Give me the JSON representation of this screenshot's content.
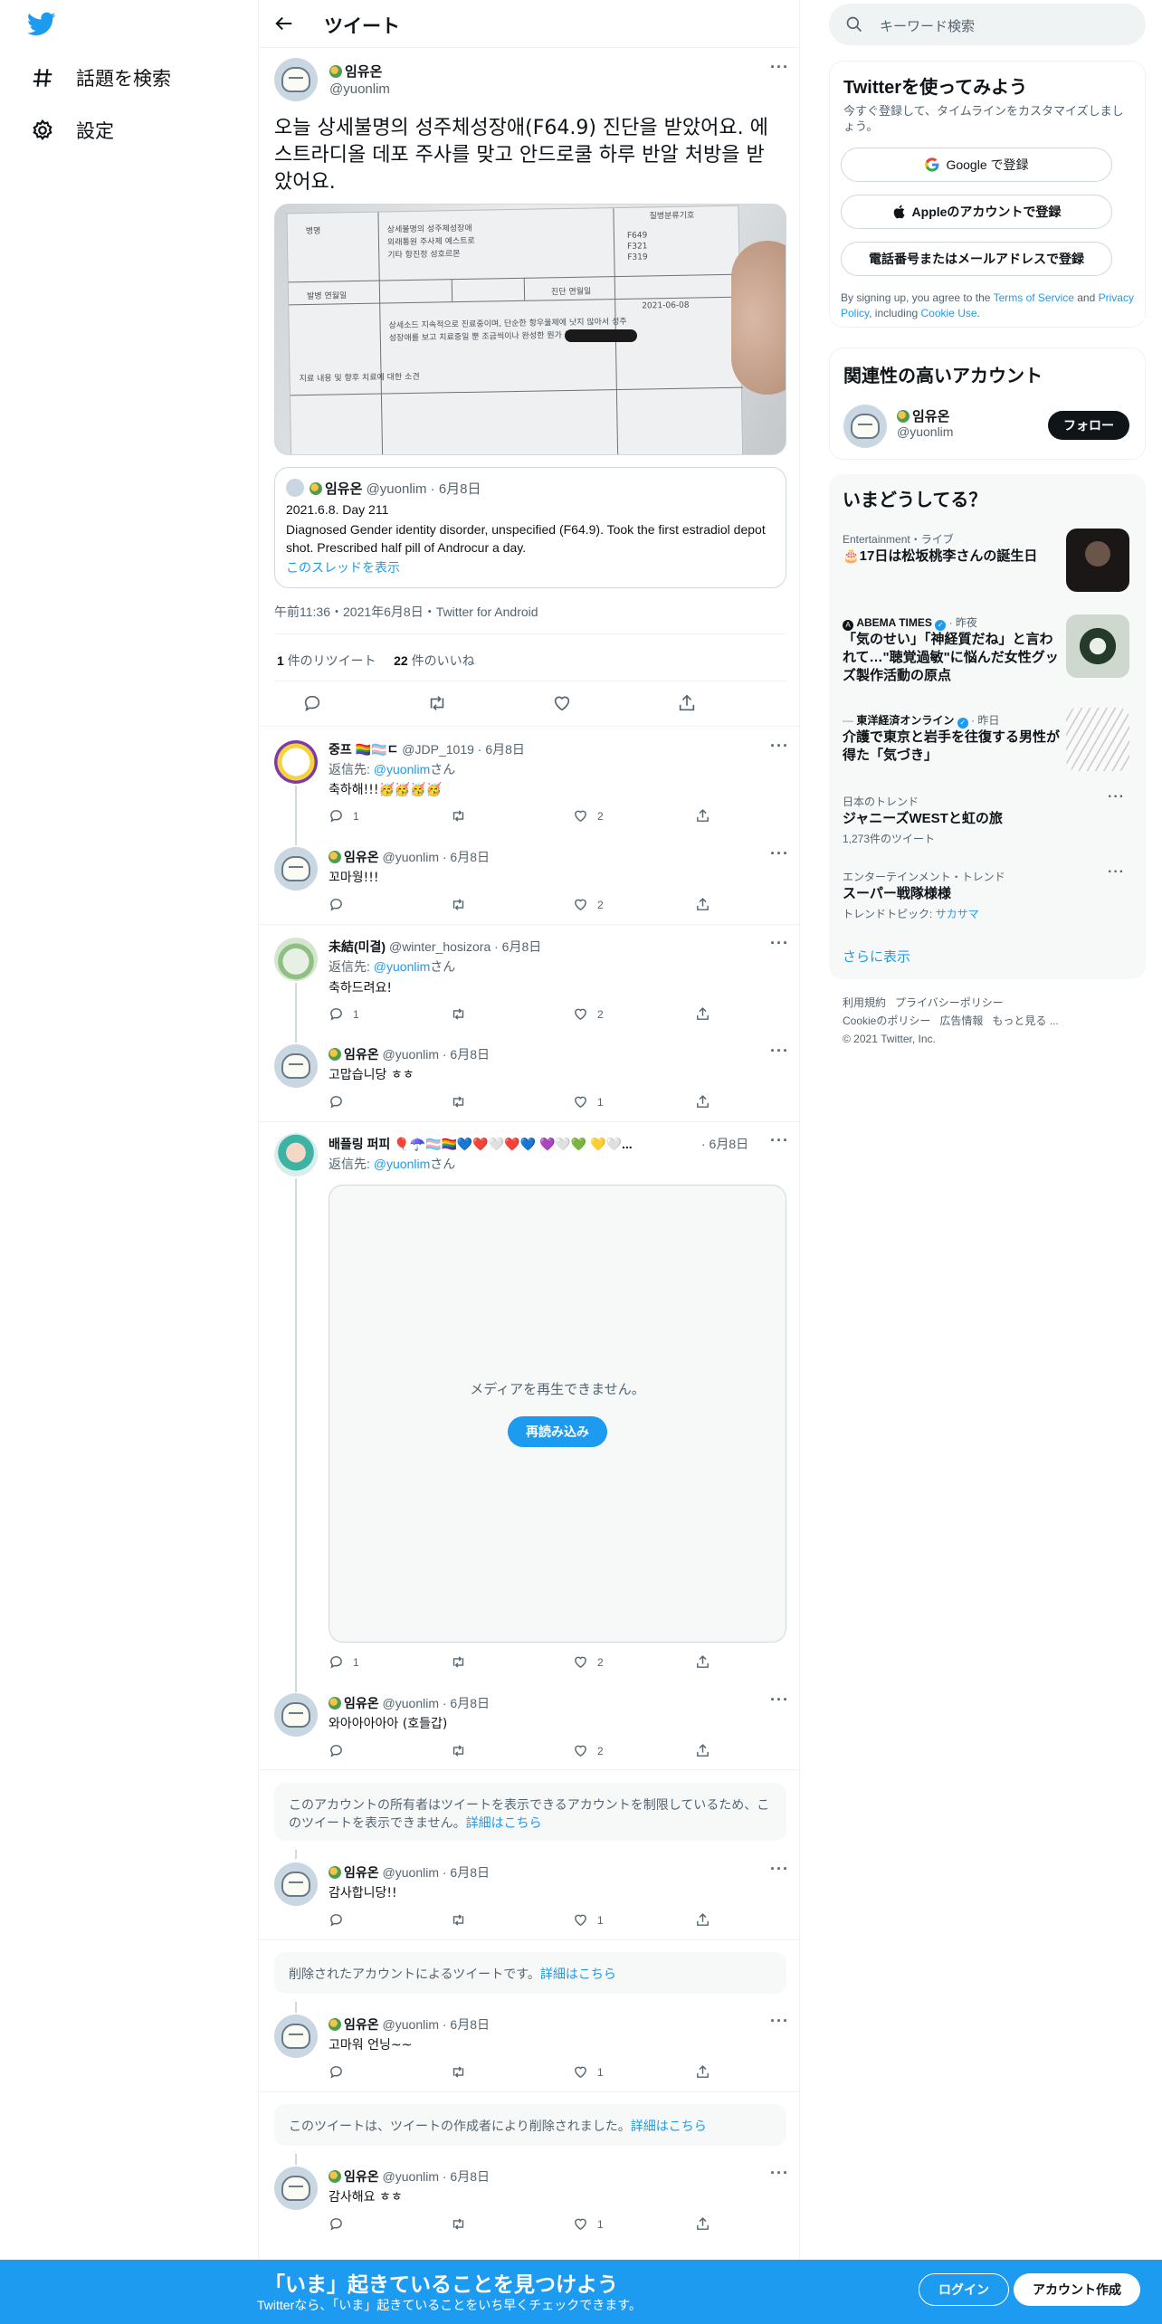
{
  "nav": {
    "explore_label": "話題を検索",
    "settings_label": "設定"
  },
  "header": {
    "title": "ツイート"
  },
  "main_tweet": {
    "name": "임유온",
    "handle": "@yuonlim",
    "text": "오늘 상세불명의 성주체성장애(F64.9) 진단을 받았어요. 에스트라디올 데포 주사를 맞고 안드로쿨 하루 반알 처방을 받았어요.",
    "quote": {
      "name": "임유온",
      "handle_date": "@yuonlim · 6月8日",
      "line1": "2021.6.8. Day 211",
      "line2": "Diagnosed Gender identity disorder, unspecified (F64.9). Took the first estradiol depot shot. Prescribed half pill of Androcur a day.",
      "thread_link": "このスレッドを表示"
    },
    "timestamp": "午前11:36・2021年6月8日・Twitter for Android",
    "retweets_count": "1",
    "retweets_label": " 件のリツイート",
    "likes_count": "22",
    "likes_label": " 件のいいね",
    "photo_text": {
      "t1": "상세불명의 성주체성장애",
      "t2": "외래통원 주사제 예스트로",
      "t3": "기타 항진정 성호르몬",
      "t4": "F649",
      "t5": "F321",
      "t6": "F319",
      "t7": "2021-06-08",
      "t8": "상세소드 지속적으로 진료중이며, 단순한 항우울제에 낫지 않아서 성주",
      "t9": "성장애를 보고 치료중일 뿐 조금씩이나 완성한 뭔가 봅니다.",
      "t10": "지료 내용 및 향후 치료에 대한 소견",
      "t11": "병명",
      "t12": "발병 연월일",
      "t13": "진단 연월일",
      "t14": "질병분류기호"
    }
  },
  "replies": [
    {
      "name": "중프 🏳️‍🌈🏳️‍⚧️ㄷ",
      "handle_date": "@JDP_1019 · 6月8日",
      "reply_to_prefix": "返信先: ",
      "reply_to_handle": "@yuonlim",
      "reply_to_suffix": "さん",
      "text": "축하해!!!🥳🥳🥳🥳",
      "reply": "1",
      "retweet": "",
      "like": "2"
    },
    {
      "name": "임유온",
      "handle_date": "@yuonlim · 6月8日",
      "text": "꼬마웡!!!",
      "reply": "",
      "retweet": "",
      "like": "2"
    },
    {
      "name": "未結(미결)",
      "handle_date": "@winter_hosizora · 6月8日",
      "reply_to_prefix": "返信先: ",
      "reply_to_handle": "@yuonlim",
      "reply_to_suffix": "さん",
      "text": "축하드려요!",
      "reply": "1",
      "retweet": "",
      "like": "2"
    },
    {
      "name": "임유온",
      "handle_date": "@yuonlim · 6月8日",
      "text": "고맙습니당 ㅎㅎ",
      "reply": "",
      "retweet": "",
      "like": "1"
    },
    {
      "name": "배플링 퍼피 🎈☂️🏳️‍⚧️🏳️‍🌈💙❤️🤍❤️💙 💜🤍💚 💛🤍...",
      "handle_date": "· 6月8日",
      "reply_to_prefix": "返信先: ",
      "reply_to_handle": "@yuonlim",
      "reply_to_suffix": "さん",
      "text": "",
      "reply": "1",
      "retweet": "",
      "like": "2"
    },
    {
      "name": "임유온",
      "handle_date": "@yuonlim · 6月8日",
      "text": "와아아아아아 (호들갑)",
      "reply": "",
      "retweet": "",
      "like": "2"
    },
    {
      "name": "임유온",
      "handle_date": "@yuonlim · 6月8日",
      "text": "감사합니당!!",
      "reply": "",
      "retweet": "",
      "like": "1"
    },
    {
      "name": "임유온",
      "handle_date": "@yuonlim · 6月8日",
      "text": "고마워 언닝~~",
      "reply": "",
      "retweet": "",
      "like": "1"
    },
    {
      "name": "임유온",
      "handle_date": "@yuonlim · 6月8日",
      "text": "감사해요 ㅎㅎ",
      "reply": "",
      "retweet": "",
      "like": "1"
    }
  ],
  "video": {
    "message": "メディアを再生できません。",
    "reload": "再読み込み"
  },
  "notices": {
    "protected": "このアカウントの所有者はツイートを表示できるアカウントを制限しているため、このツイートを表示できません。",
    "protected_link": "詳細はこちら",
    "deleted_account": "削除されたアカウントによるツイートです。",
    "deleted_account_link": "詳細はこちら",
    "deleted_tweet": "このツイートは、ツイートの作成者により削除されました。",
    "deleted_tweet_link": "詳細はこちら"
  },
  "sidebar": {
    "search_placeholder": "キーワード検索",
    "signup": {
      "title": "Twitterを使ってみよう",
      "desc": "今すぐ登録して、タイムラインをカスタマイズしましょう。",
      "google": "Google で登録",
      "apple": "Appleのアカウントで登録",
      "phone": "電話番号またはメールアドレスで登録",
      "legal_pre": "By signing up, you agree to the ",
      "tos": "Terms of Service",
      "legal_and": " and ",
      "privacy": "Privacy Policy",
      "legal_including": ", including ",
      "cookie": "Cookie Use",
      "legal_end": "."
    },
    "related": {
      "title": "関連性の高いアカウント",
      "name": "임유온",
      "handle": "@yuonlim",
      "follow": "フォロー"
    },
    "trends": {
      "title": "いまどうしてる？",
      "items": [
        {
          "meta": "Entertainment・ライブ",
          "title": "🎂17日は松坂桃李さんの誕生日"
        },
        {
          "meta_source": "ABEMA TIMES",
          "meta_time": " · 昨夜",
          "title": "「気のせい」「神経質だね」と言われて…\"聴覚過敏\"に悩んだ女性グッズ製作活動の原点"
        },
        {
          "meta_source": "東洋経済オンライン",
          "meta_time": " · 昨日",
          "title": "介護で東京と岩手を往復する男性が得た「気づき」"
        },
        {
          "meta": "日本のトレンド",
          "title": "ジャニーズWESTと虹の旅",
          "sub": "1,273件のツイート"
        },
        {
          "meta": "エンターテインメント・トレンド",
          "title": "スーパー戦隊様様",
          "sub_prefix": "トレンドトピック: ",
          "sub_link": "サカサマ"
        }
      ],
      "show_more": "さらに表示"
    },
    "footer": {
      "terms": "利用規約",
      "privacy": "プライバシーポリシー",
      "cookie": "Cookieのポリシー",
      "ads": "広告情報",
      "more": "もっと見る ...",
      "copyright": "© 2021 Twitter, Inc."
    }
  },
  "bottom_bar": {
    "title": "「いま」起きていることを見つけよう",
    "subtitle": "Twitterなら、「いま」起きていることをいち早くチェックできます。",
    "login": "ログイン",
    "signup": "アカウント作成"
  },
  "colors": {
    "accent": "#1d9bf0",
    "text": "#0f1419",
    "muted": "#536471",
    "border": "#eff3f4"
  }
}
